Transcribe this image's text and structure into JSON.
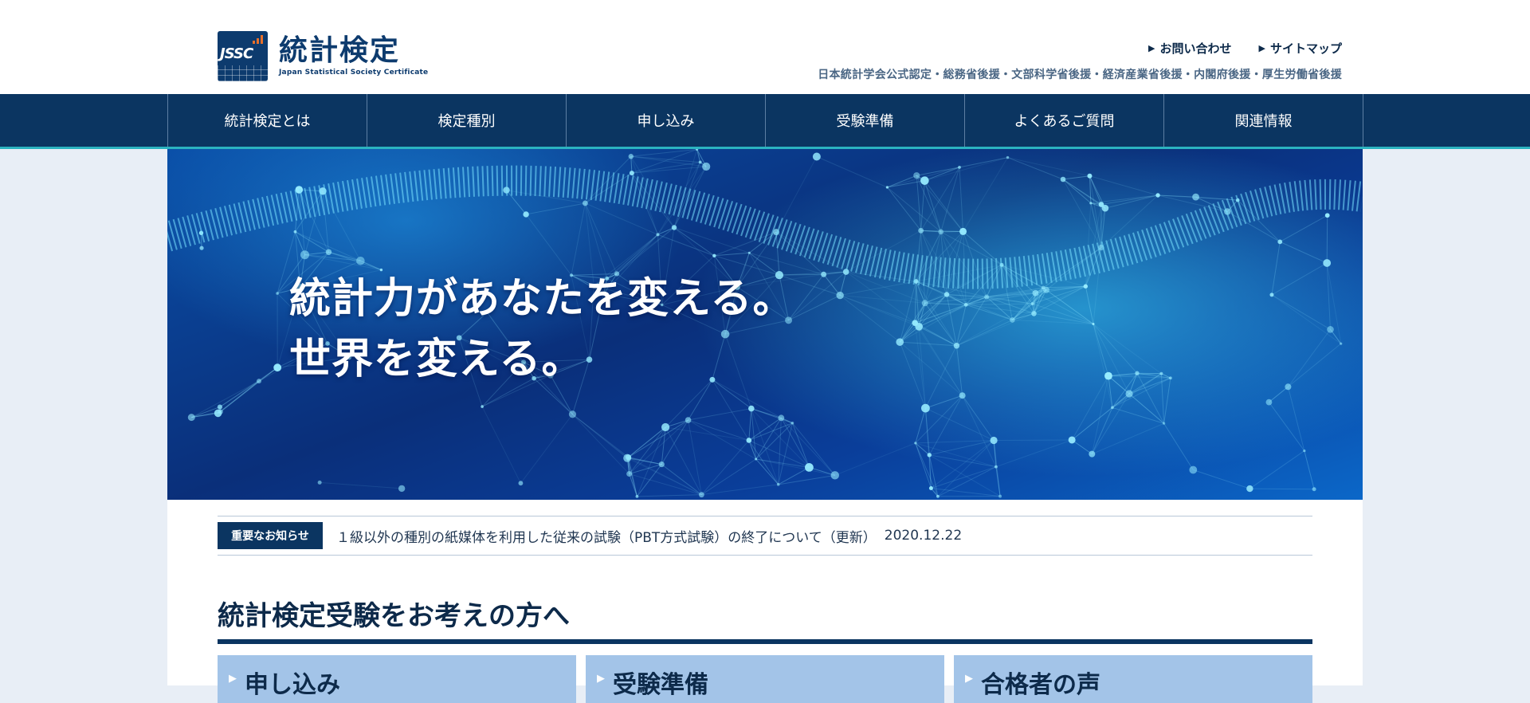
{
  "header": {
    "logo_mark": "JSSC",
    "logo_title": "統計検定",
    "logo_subtitle": "Japan Statistical Society Certificate",
    "util_links": [
      {
        "label": "お問い合わせ"
      },
      {
        "label": "サイトマップ"
      }
    ],
    "endorsement": "日本統計学会公式認定・総務省後援・文部科学省後援・経済産業省後援・内閣府後援・厚生労働省後援"
  },
  "nav": {
    "items": [
      {
        "label": "統計検定とは"
      },
      {
        "label": "検定種別"
      },
      {
        "label": "申し込み"
      },
      {
        "label": "受験準備"
      },
      {
        "label": "よくあるご質問"
      },
      {
        "label": "関連情報"
      }
    ]
  },
  "hero": {
    "line1": "統計力があなたを変える。",
    "line2": "世界を変える。"
  },
  "notice": {
    "badge": "重要なお知らせ",
    "text": "１級以外の種別の紙媒体を利用した従来の試験（PBT方式試験）の終了について（更新）",
    "date": "2020.12.22"
  },
  "section": {
    "title": "統計検定受験をお考えの方へ",
    "cards": [
      {
        "label": "申し込み"
      },
      {
        "label": "受験準備"
      },
      {
        "label": "合格者の声"
      }
    ]
  },
  "colors": {
    "brand_navy": "#0b3561",
    "accent_teal": "#2bb3c0",
    "card_blue": "#a3c4e8",
    "page_bg": "#e8eef6"
  },
  "icons": {
    "util_link": "triangle-right-icon",
    "card": "triangle-right-icon"
  }
}
